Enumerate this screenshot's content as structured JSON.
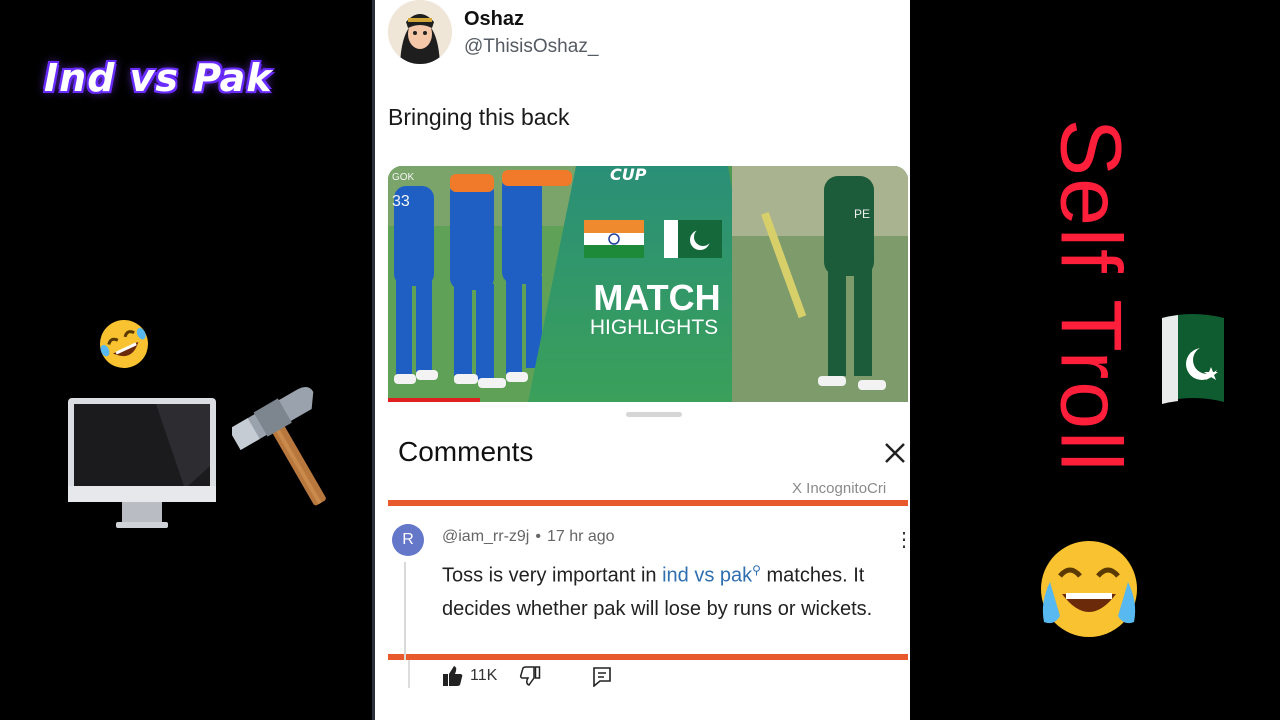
{
  "left_caption": {
    "title": "Ind vs Pak"
  },
  "right_caption": {
    "title": "Self Troll"
  },
  "post": {
    "user_name": "Oshaz",
    "user_handle": "@ThisisOshaz_",
    "text": "Bringing this back",
    "media": {
      "cup_text": "CUP",
      "match_text": "MATCH",
      "highlights_text": "HIGHLIGHTS",
      "jersey_number": "33",
      "jersey_left_text": "GOK",
      "jersey_right_text": "PE"
    }
  },
  "comments": {
    "title": "Comments",
    "watermark": "X IncognitoCri",
    "comment": {
      "avatar_letter": "R",
      "username": "@iam_rr-z9j",
      "time": "17 hr ago",
      "text_before": "Toss is very important in ",
      "link_text": "ind vs pak",
      "search_mark": "⚲",
      "text_after": " matches. It decides whether pak will lose by runs or wickets.",
      "likes": "11K"
    }
  },
  "colors": {
    "accent_orange": "#e85a2c",
    "self_troll_red": "#ff1f3a",
    "ind_vs_pak_glow": "#6a2cff",
    "link_blue": "#2f6fb0"
  },
  "icons": [
    "rofl-emoji-icon",
    "monitor-icon",
    "hammer-icon",
    "pakistan-flag-icon",
    "joy-emoji-icon",
    "close-icon",
    "thumbs-up-icon",
    "thumbs-down-icon",
    "reply-icon",
    "more-vert-icon"
  ]
}
